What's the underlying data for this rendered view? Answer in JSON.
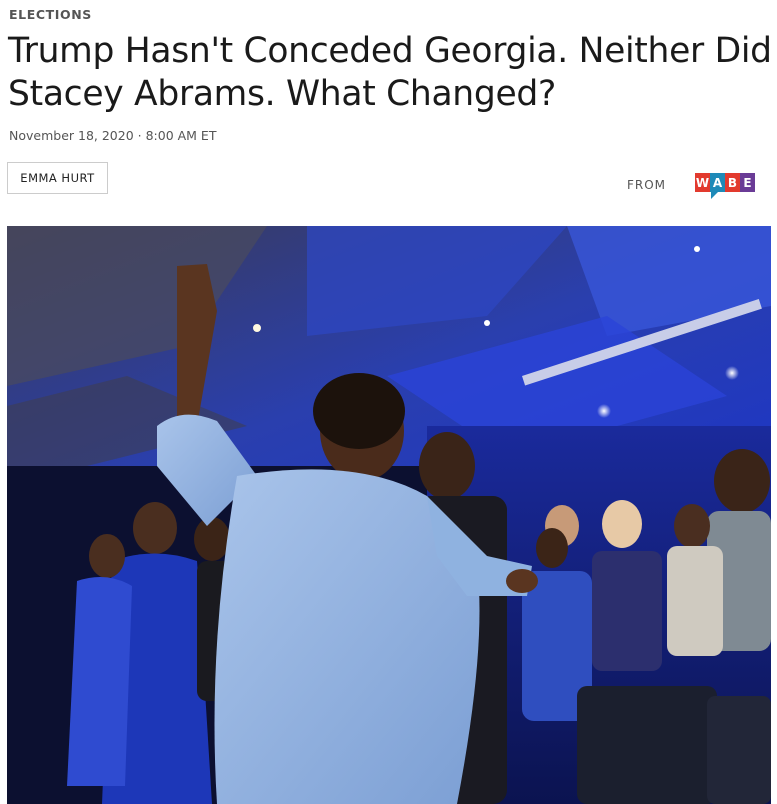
{
  "article": {
    "section": "ELECTIONS",
    "headline": "Trump Hasn't Conceded Georgia. Neither Did Stacey Abrams. What Changed?",
    "dateline": "November 18, 2020 · 8:00 AM ET",
    "author": "EMMA HURT",
    "from_label": "FROM",
    "station": {
      "letters": [
        "W",
        "A",
        "B",
        "E"
      ],
      "colors": [
        "#e23a2e",
        "#1e8ab8",
        "#e23a2e",
        "#6a3b96"
      ]
    }
  },
  "colors": {
    "text": "#1a1a1a",
    "meta": "#555555",
    "border": "#cccccc",
    "stage_blue": "#1d3bd6",
    "dress_blue": "#8fb2e0"
  }
}
